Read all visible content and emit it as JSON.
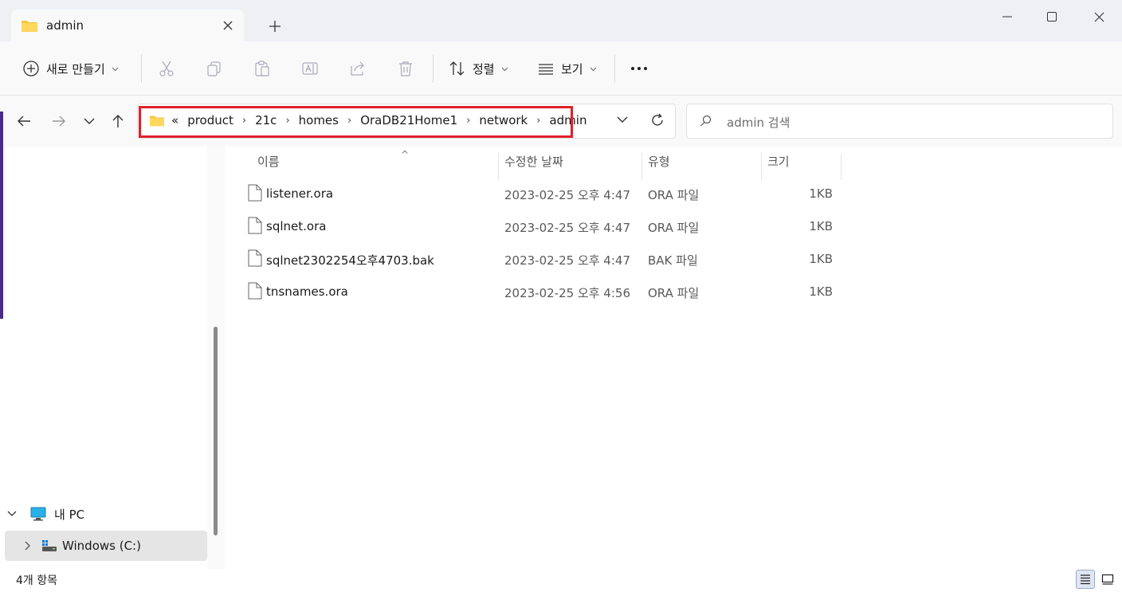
{
  "tab": {
    "title": "admin"
  },
  "toolbar": {
    "new_label": "새로 만들기",
    "sort_label": "정렬",
    "view_label": "보기",
    "more_label": "···"
  },
  "address": {
    "overflow": "«",
    "crumbs": [
      "product",
      "21c",
      "homes",
      "OraDB21Home1",
      "network",
      "admin"
    ]
  },
  "search": {
    "placeholder": "admin 검색"
  },
  "columns": {
    "name": "이름",
    "date": "수정한 날짜",
    "type": "유형",
    "size": "크기"
  },
  "files": [
    {
      "name": "listener.ora",
      "date": "2023-02-25 오후 4:47",
      "type": "ORA 파일",
      "size": "1KB"
    },
    {
      "name": "sqlnet.ora",
      "date": "2023-02-25 오후 4:47",
      "type": "ORA 파일",
      "size": "1KB"
    },
    {
      "name": "sqlnet2302254오후4703.bak",
      "date": "2023-02-25 오후 4:47",
      "type": "BAK 파일",
      "size": "1KB"
    },
    {
      "name": "tnsnames.ora",
      "date": "2023-02-25 오후 4:56",
      "type": "ORA 파일",
      "size": "1KB"
    }
  ],
  "nav": {
    "this_pc": "내 PC",
    "drive_c": "Windows  (C:)"
  },
  "status": {
    "item_count": "4개 항목"
  },
  "colors": {
    "highlight": "#e0202a",
    "folder": "#f4c542",
    "accent": "#0067c0"
  }
}
